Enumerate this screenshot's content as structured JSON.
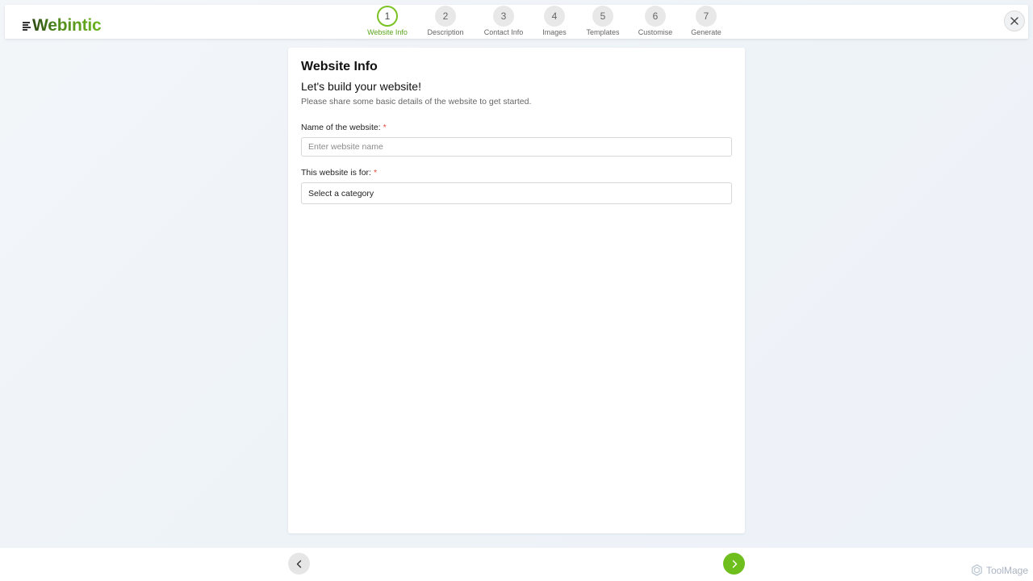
{
  "brand": {
    "name": "Webintic"
  },
  "steps": [
    {
      "number": "1",
      "label": "Website Info",
      "active": true
    },
    {
      "number": "2",
      "label": "Description",
      "active": false
    },
    {
      "number": "3",
      "label": "Contact Info",
      "active": false
    },
    {
      "number": "4",
      "label": "Images",
      "active": false
    },
    {
      "number": "5",
      "label": "Templates",
      "active": false
    },
    {
      "number": "6",
      "label": "Customise",
      "active": false
    },
    {
      "number": "7",
      "label": "Generate",
      "active": false
    }
  ],
  "header": {
    "close_icon": "close-icon"
  },
  "form": {
    "title": "Website Info",
    "heading": "Let's build your website!",
    "subtitle": "Please share some basic details of the website to get started.",
    "name_field": {
      "label": "Name of the website:",
      "required_mark": "*",
      "placeholder": "Enter website name",
      "value": ""
    },
    "category_field": {
      "label": "This website is for:",
      "required_mark": "*",
      "selected": "Select a category"
    }
  },
  "nav": {
    "back_icon": "chevron-left-icon",
    "next_icon": "chevron-right-icon"
  },
  "watermark": {
    "text": "ToolMage"
  },
  "colors": {
    "accent": "#6ebf1e",
    "active_step_border": "#7bc224",
    "required": "#e24b3b"
  }
}
